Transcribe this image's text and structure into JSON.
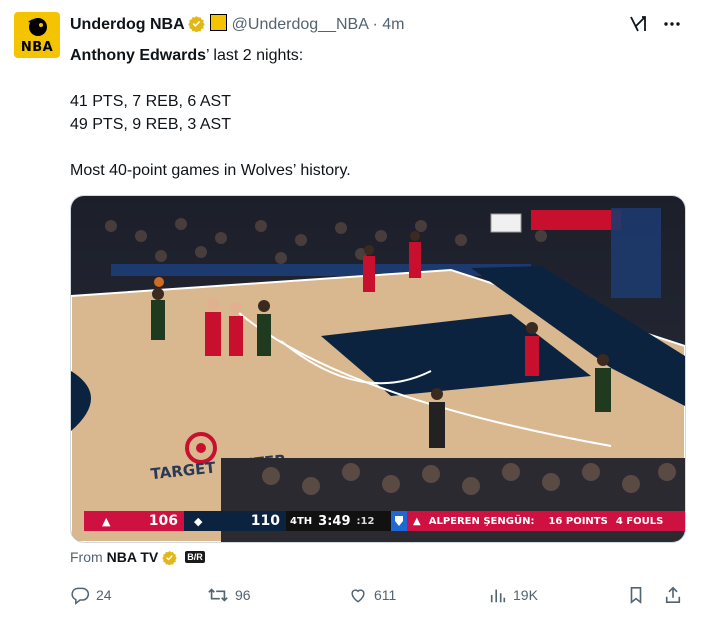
{
  "author": {
    "display_name": "Underdog NBA",
    "handle": "@Underdog__NBA",
    "separator": "·",
    "time": "4m",
    "avatar_text": "NBA"
  },
  "tweet": {
    "player_name": "Anthony Edwards",
    "line1_rest": "’ last 2 nights:",
    "stat_line_1": "41 PTS, 7 REB, 6 AST",
    "stat_line_2": "49 PTS, 9 REB, 3 AST",
    "closing": "Most 40-point games in Wolves’ history."
  },
  "video": {
    "court_text": "TARGET CENTER",
    "scorebug": {
      "home_score": "106",
      "away_score": "110",
      "quarter": "4TH",
      "clock": "3:49",
      "shot_clock": ":12",
      "player_name": "ALPEREN ŞENGÜN:",
      "stat": "16 POINTS",
      "fouls": "4 FOULS"
    }
  },
  "source": {
    "prefix": "From",
    "name": "NBA TV",
    "badge": "B/R"
  },
  "actions": {
    "replies": "24",
    "reposts": "96",
    "likes": "611",
    "views": "19K"
  },
  "colors": {
    "accent_yellow": "#f5c400",
    "text_secondary": "#536471",
    "rockets_red": "#ce1141",
    "wolves_navy": "#0c2340"
  }
}
